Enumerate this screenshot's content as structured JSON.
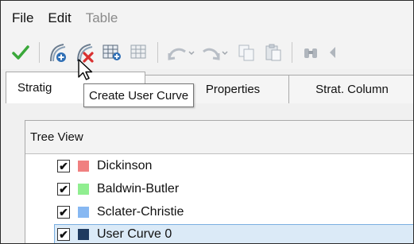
{
  "menubar": {
    "items": [
      {
        "label": "File",
        "disabled": false
      },
      {
        "label": "Edit",
        "disabled": false
      },
      {
        "label": "Table",
        "disabled": true
      }
    ]
  },
  "toolbar": {
    "icons": [
      "checkmark-icon",
      "create-user-curve-icon",
      "delete-curve-icon",
      "table-add-icon",
      "table-icon",
      "undo-icon",
      "redo-icon",
      "copy-icon",
      "paste-icon",
      "binoculars-icon",
      "arrow-icon"
    ]
  },
  "tooltip": {
    "text": "Create User Curve"
  },
  "tabs": [
    {
      "label": "Stratig",
      "active": true
    },
    {
      "label": "Properties",
      "active": false
    },
    {
      "label": "Strat. Column",
      "active": false
    }
  ],
  "tree": {
    "title": "Tree View",
    "items": [
      {
        "label": "Dickinson",
        "checked": true,
        "color": "#f08080"
      },
      {
        "label": "Baldwin-Butler",
        "checked": true,
        "color": "#90ee90"
      },
      {
        "label": "Sclater-Christie",
        "checked": true,
        "color": "#87b8f2"
      },
      {
        "label": "User Curve 0",
        "checked": true,
        "color": "#1f3a5f",
        "selected": true
      }
    ]
  },
  "colors": {
    "accent_green": "#3aa83a",
    "accent_blue": "#2f6fb5",
    "delete_red": "#d93030",
    "selection_bg": "#dbeaf7"
  }
}
